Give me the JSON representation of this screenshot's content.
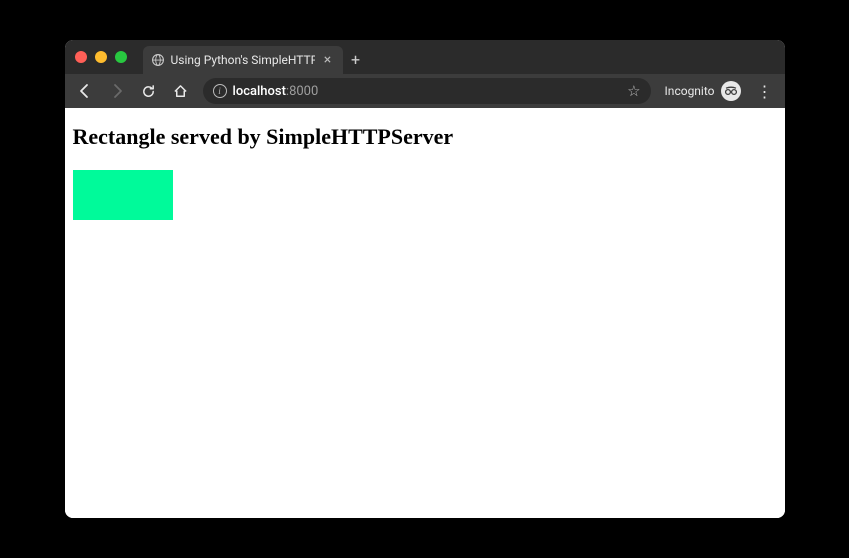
{
  "window": {
    "tab_title": "Using Python's SimpleHTTPSe"
  },
  "toolbar": {
    "url_host": "localhost",
    "url_port": ":8000",
    "incognito_label": "Incognito"
  },
  "page": {
    "heading": "Rectangle served by SimpleHTTPServer",
    "rect_color": "#00fa9a"
  }
}
